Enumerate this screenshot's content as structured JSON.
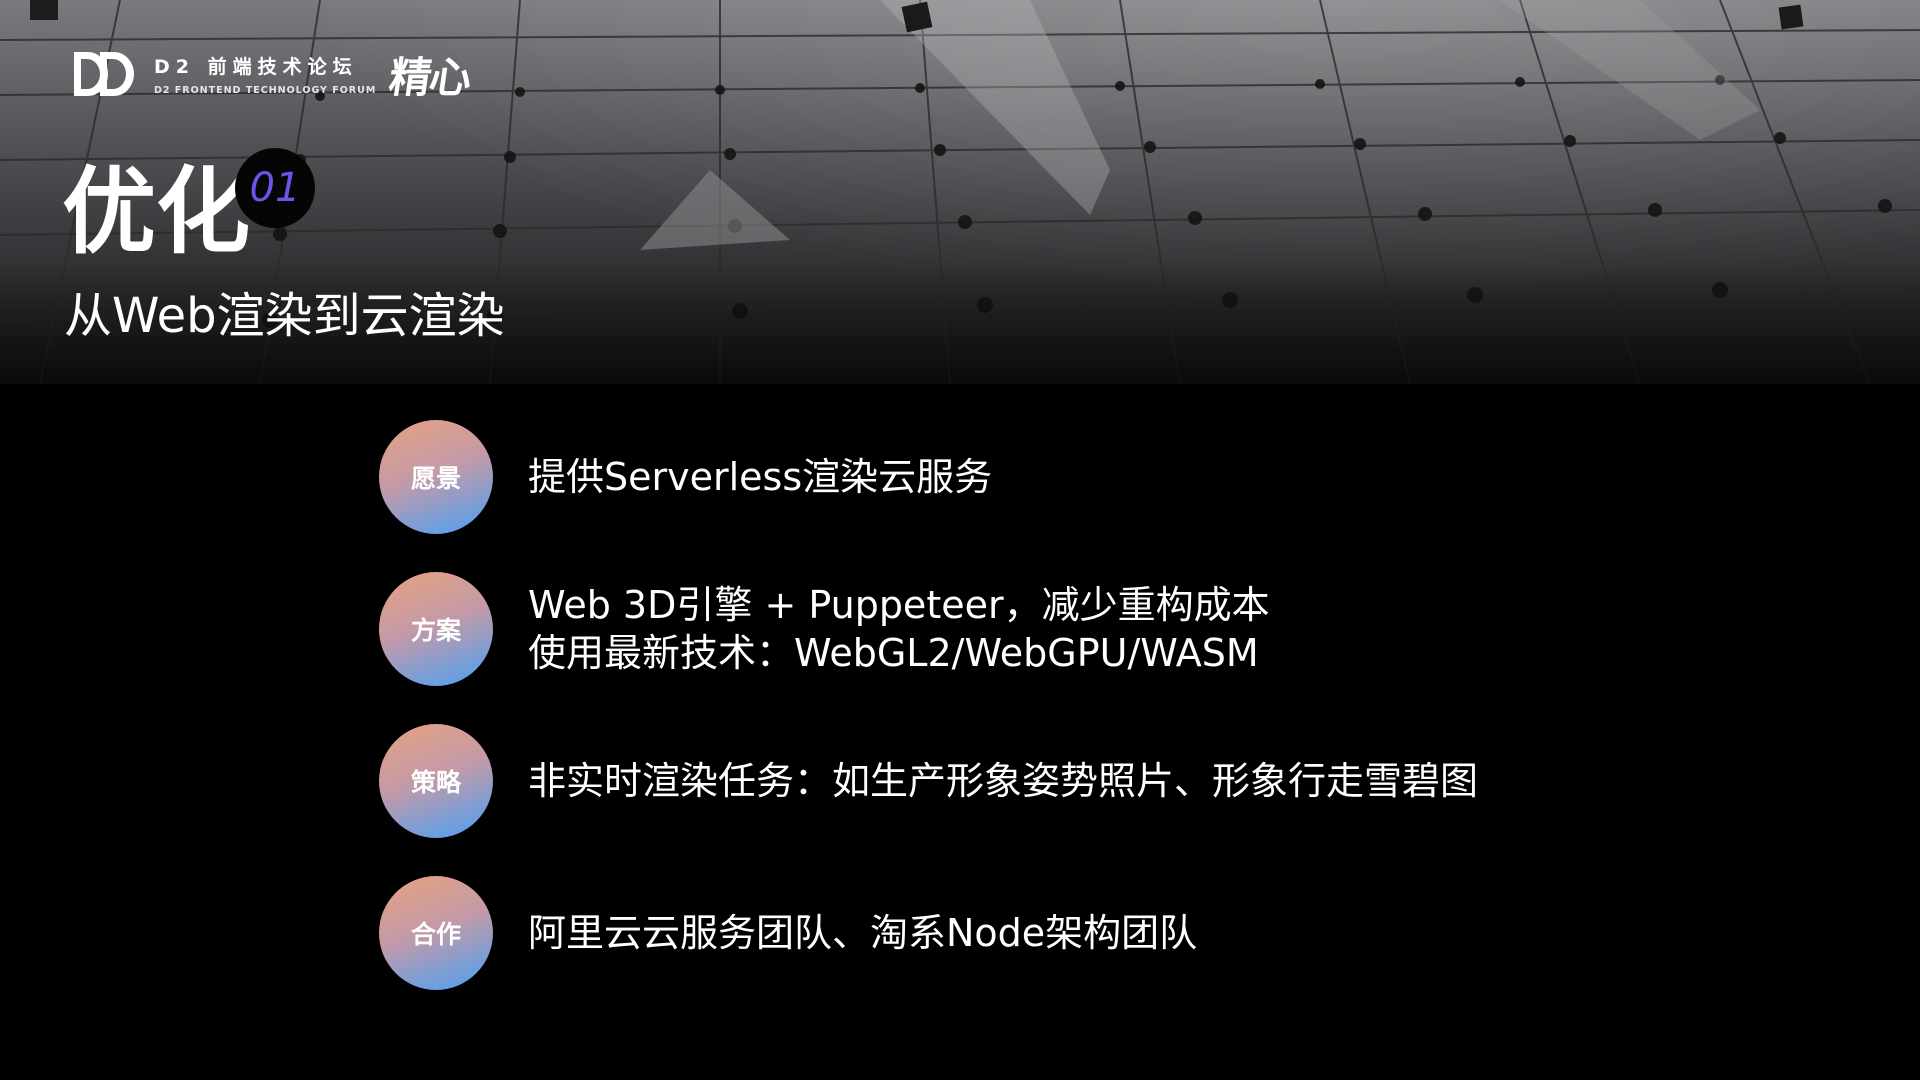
{
  "brand": {
    "title": "D2 前端技术论坛",
    "subtitle": "D2 FRONTEND TECHNOLOGY FORUM",
    "tagline": "精心",
    "logo_icon": "d2-logo-icon"
  },
  "section": {
    "title": "优化",
    "number": "01",
    "subtitle": "从Web渲染到云渲染"
  },
  "items": [
    {
      "badge": "愿景",
      "lines": [
        "提供Serverless渲染云服务"
      ]
    },
    {
      "badge": "方案",
      "lines": [
        "Web 3D引擎 + Puppeteer，减少重构成本",
        "使用最新技术：WebGL2/WebGPU/WASM"
      ]
    },
    {
      "badge": "策略",
      "lines": [
        "非实时渲染任务：如生产形象姿势照片、形象行走雪碧图"
      ]
    },
    {
      "badge": "合作",
      "lines": [
        "阿里云云服务团队、淘系Node架构团队"
      ]
    }
  ],
  "colors": {
    "background": "#000000",
    "badge_gradient_start": "#e6a37f",
    "badge_gradient_end": "#4aa0f7",
    "number_accent": "#6f52e8"
  }
}
